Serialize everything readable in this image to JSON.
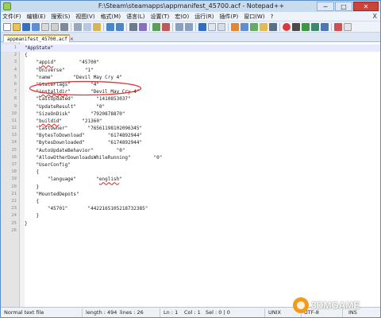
{
  "window": {
    "title": "F:\\Steam\\steamapps\\appmanifest_45700.acf - Notepad++",
    "controls": [
      "─",
      "□",
      "✕"
    ]
  },
  "menu": [
    "文件(F)",
    "编辑(E)",
    "搜索(S)",
    "视图(V)",
    "格式(M)",
    "语言(L)",
    "设置(T)",
    "宏(O)",
    "运行(R)",
    "插件(P)",
    "窗口(W)",
    "?"
  ],
  "menu_close": "X",
  "tab": {
    "label": "appmanifest_45700.acf",
    "close": "✕"
  },
  "editor": {
    "lines": [
      {
        "n": "1",
        "text": "\"AppState\""
      },
      {
        "n": "2",
        "text": "{"
      },
      {
        "n": "3",
        "pre": "    \"",
        "spell": "appid",
        "post": "\"        \"45700\""
      },
      {
        "n": "4",
        "text": "    \"Universe\"       \"1\""
      },
      {
        "n": "5",
        "text": "    \"name\"       \"Devil May Cry 4\""
      },
      {
        "n": "6",
        "text": "    \"StateFlags\"       \"4\""
      },
      {
        "n": "7",
        "pre": "    \"",
        "spell": "installdir",
        "post": "\"       \"Devil May Cry 4\""
      },
      {
        "n": "8",
        "text": "    \"LastUpdated\"        \"1410853037\""
      },
      {
        "n": "9",
        "text": "    \"UpdateResult\"       \"0\""
      },
      {
        "n": "10",
        "text": "    \"SizeOnDisk\"       \"7920878870\""
      },
      {
        "n": "11",
        "pre": "    \"",
        "spell": "buildid",
        "post": "\"       \"21360\""
      },
      {
        "n": "12",
        "text": "    \"LastOwner\"       \"76561198102096345\""
      },
      {
        "n": "13",
        "text": "    \"BytesToDownload\"        \"6174892944\""
      },
      {
        "n": "14",
        "text": "    \"BytesDownloaded\"        \"6174892944\""
      },
      {
        "n": "15",
        "text": "    \"AutoUpdateBehavior\"        \"0\""
      },
      {
        "n": "16",
        "text": "    \"AllowOtherDownloadsWhileRunning\"        \"0\""
      },
      {
        "n": "17",
        "text": "    \"UserConfig\""
      },
      {
        "n": "18",
        "text": "    {"
      },
      {
        "n": "19",
        "pre": "        \"language\"       \"",
        "spell": "english",
        "post": "\""
      },
      {
        "n": "20",
        "text": "    }"
      },
      {
        "n": "21",
        "text": "    \"MountedDepots\""
      },
      {
        "n": "22",
        "text": "    {"
      },
      {
        "n": "23",
        "text": "        \"45701\"       \"4422165105218732385\""
      },
      {
        "n": "24",
        "text": "    }"
      },
      {
        "n": "25",
        "text": "}"
      },
      {
        "n": "26",
        "text": ""
      }
    ]
  },
  "status": {
    "type": "Normal text file",
    "length": "length : 494",
    "lines": "lines : 26",
    "ln": "Ln : 1",
    "col": "Col : 1",
    "sel": "Sel : 0 | 0",
    "eol": "UNIX",
    "encoding": "UTF-8",
    "mode": "INS"
  },
  "watermark": "3DMGAME",
  "colors": {
    "annotation": "#e03030",
    "current_line": "#e8e8ff",
    "title_bg": "#c9dbef"
  },
  "toolbar_icons": [
    "new-icon",
    "open-icon",
    "save-icon",
    "save-all-icon",
    "close-icon",
    "close-all-icon",
    "print-icon",
    "cut-icon",
    "copy-icon",
    "paste-icon",
    "undo-icon",
    "redo-icon",
    "find-icon",
    "replace-icon",
    "zoom-in-icon",
    "zoom-out-icon",
    "sync-v-icon",
    "sync-h-icon",
    "wrap-icon",
    "all-chars-icon",
    "indent-guide-icon",
    "udl-icon",
    "doc-map-icon",
    "function-list-icon",
    "folder-icon",
    "monitor-icon",
    "record-icon",
    "stop-icon",
    "play-icon",
    "play-multiple-icon",
    "save-macro-icon",
    "spellcheck-icon",
    "abc-icon"
  ]
}
